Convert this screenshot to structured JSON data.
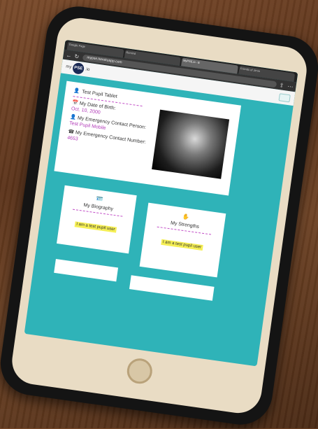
{
  "browser": {
    "tabs": [
      "Google Page",
      "Remind",
      "MyPSE.io - B",
      "Friends of Jimm"
    ],
    "url": "mypse.herokuapp.com"
  },
  "site": {
    "logo_prefix": "my",
    "logo_main": "PSE",
    "logo_suffix": ".io"
  },
  "profile": {
    "name": "Test Pupil Tablet",
    "dob_label": "My Date of Birth:",
    "dob_value": "Oct. 10, 2000",
    "contact_label": "My Emergency Contact Person:",
    "contact_value": "Test Pupil Mobile",
    "number_label": "My Emergency Contact Number:",
    "number_value": "4653"
  },
  "cards": [
    {
      "title": "My Biography",
      "text": "I am a test pupil user"
    },
    {
      "title": "My Strengths",
      "text": "I am a test pupil user"
    }
  ]
}
